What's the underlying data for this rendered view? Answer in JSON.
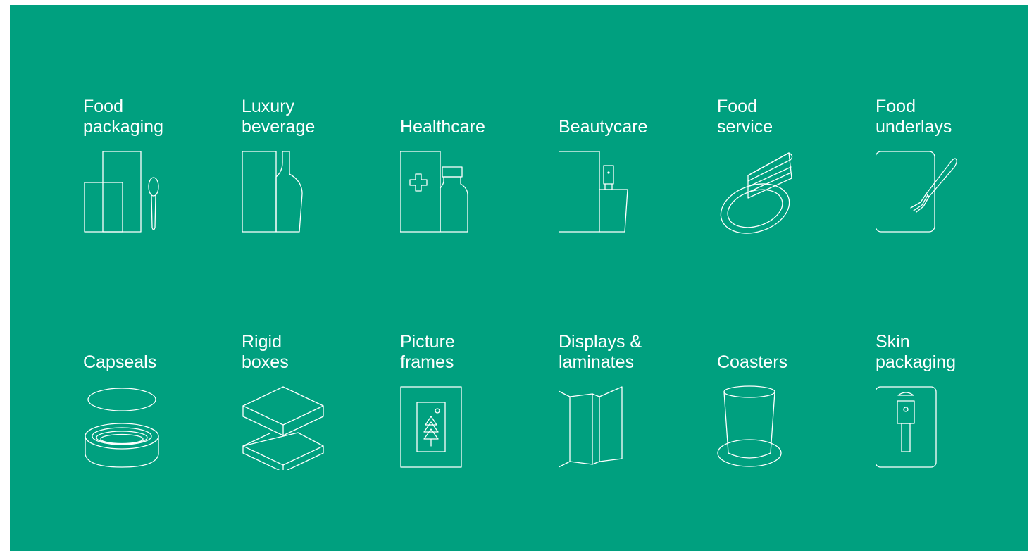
{
  "brand": {
    "background_color": "#00a07f",
    "line_color": "#ffffff"
  },
  "categories": [
    {
      "lines": [
        "Food",
        "packaging"
      ],
      "icon": "food-packaging-icon"
    },
    {
      "lines": [
        "Luxury",
        "beverage"
      ],
      "icon": "bottle-icon"
    },
    {
      "lines": [
        "Healthcare"
      ],
      "icon": "medical-kit-icon"
    },
    {
      "lines": [
        "Beautycare"
      ],
      "icon": "pump-bottle-icon"
    },
    {
      "lines": [
        "Food",
        "service"
      ],
      "icon": "cake-plate-icon"
    },
    {
      "lines": [
        "Food",
        "underlays"
      ],
      "icon": "tray-fork-icon"
    },
    {
      "lines": [
        "Capseals"
      ],
      "icon": "capseal-icon"
    },
    {
      "lines": [
        "Rigid",
        "boxes"
      ],
      "icon": "rigid-box-icon"
    },
    {
      "lines": [
        "Picture",
        "frames"
      ],
      "icon": "picture-frame-icon"
    },
    {
      "lines": [
        "Displays &",
        "laminates"
      ],
      "icon": "folding-display-icon"
    },
    {
      "lines": [
        "Coasters"
      ],
      "icon": "coaster-cup-icon"
    },
    {
      "lines": [
        "Skin",
        "packaging"
      ],
      "icon": "skin-pack-icon"
    }
  ]
}
